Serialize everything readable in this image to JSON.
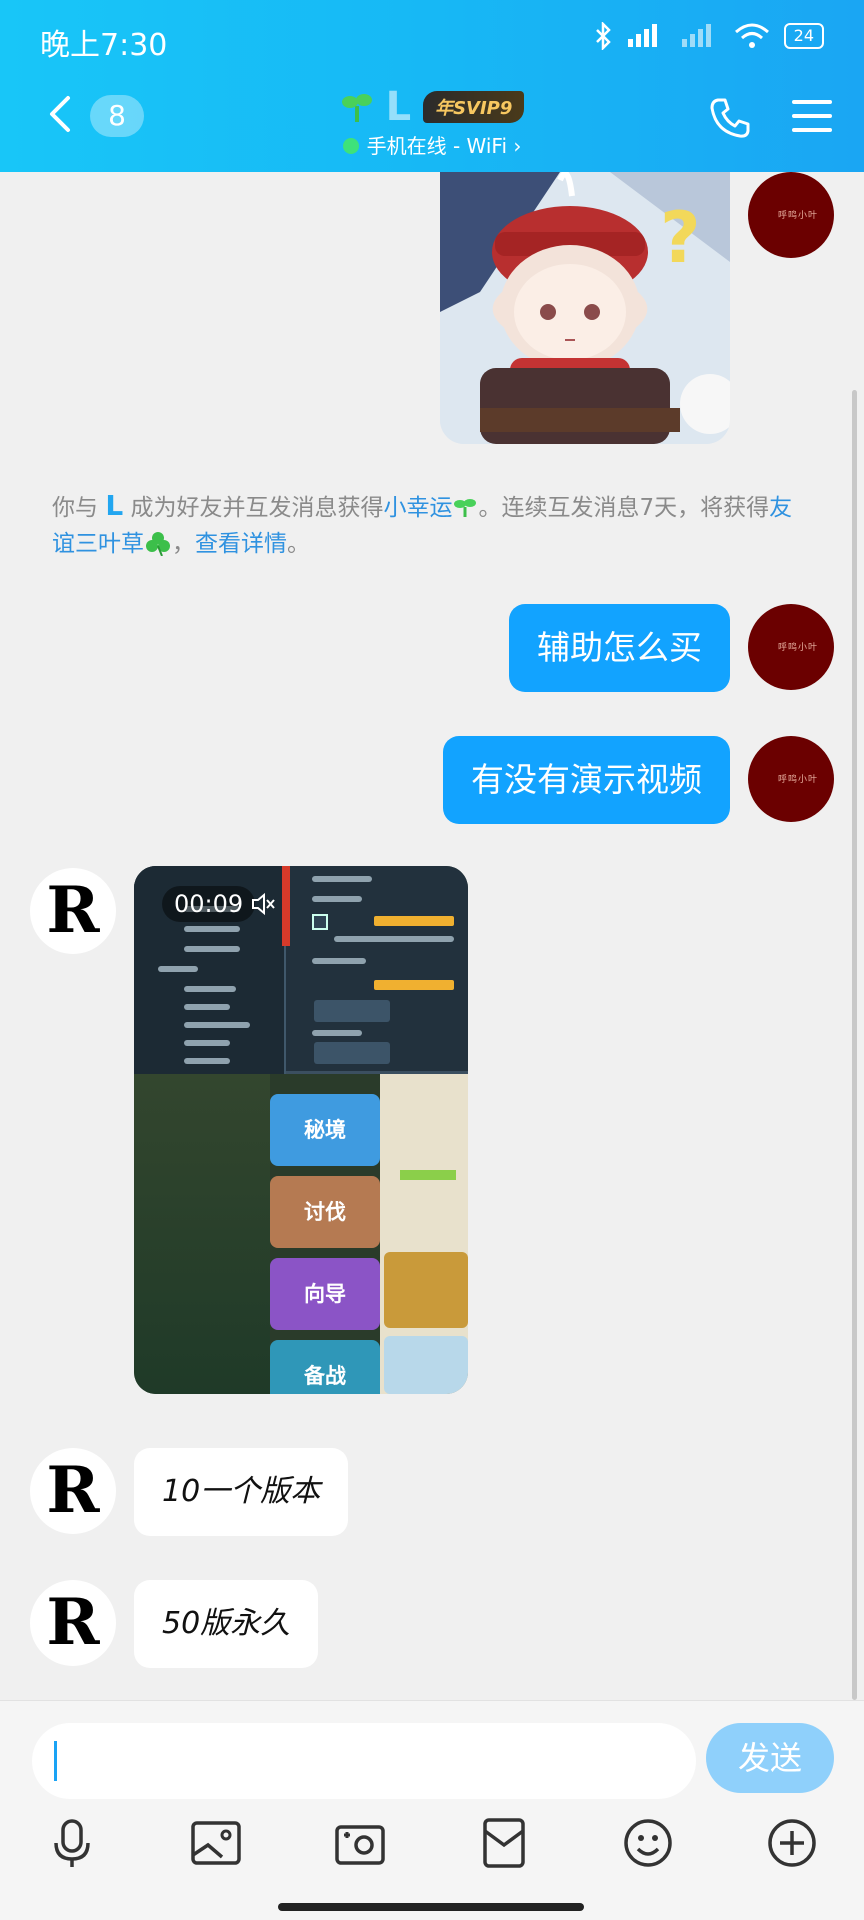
{
  "status_bar": {
    "time": "晚上7:30",
    "battery": "24"
  },
  "header": {
    "unread_count": "8",
    "contact_name": "L",
    "svip_badge": "年SVIP9",
    "online_status": "手机在线 - WiFi ›"
  },
  "chat": {
    "system_notice": {
      "part1": "你与 ",
      "name": "L",
      "part2": " 成为好友并互发消息获得",
      "link1": "小幸运",
      "part3": "。连续互发消息7天，将获得",
      "link2": "友谊三叶草",
      "part4": "，",
      "link3": "查看详情",
      "part5": "。"
    },
    "messages": [
      {
        "sender": "self",
        "text": "辅助怎么买"
      },
      {
        "sender": "self",
        "text": "有没有演示视频"
      },
      {
        "sender": "other",
        "type": "video",
        "duration": "00:09",
        "buttons": [
          "秘境",
          "讨伐",
          "向导",
          "备战"
        ]
      },
      {
        "sender": "other",
        "text": "10一个版本"
      },
      {
        "sender": "other",
        "text": "50版永久"
      }
    ],
    "other_avatar_letter": "R",
    "self_avatar_scribble": "呼鸣小叶"
  },
  "input": {
    "send_label": "发送"
  },
  "toolbar": [
    "mic-icon",
    "image-icon",
    "camera-icon",
    "red-packet-icon",
    "emoji-icon",
    "plus-icon"
  ],
  "colors": {
    "header": "#17b8f5",
    "self_bubble": "#12a3ff",
    "send_disabled": "#8fd0fb",
    "link": "#2f92e0"
  }
}
